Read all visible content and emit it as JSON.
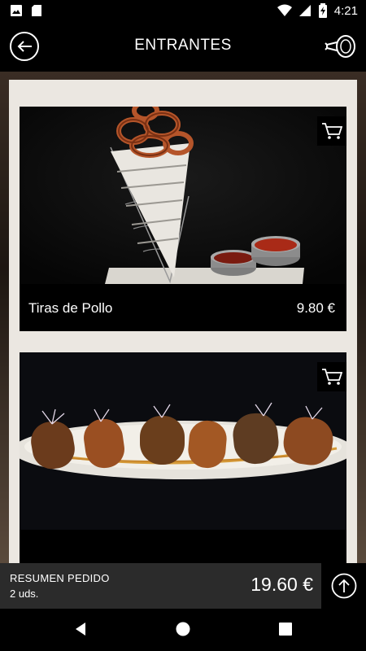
{
  "status_bar": {
    "time": "4:21",
    "left_icons": [
      "image-notification-icon",
      "sd-card-icon"
    ],
    "right_icons": [
      "wifi-icon",
      "signal-icon",
      "battery-icon"
    ]
  },
  "header": {
    "title": "ENTRANTES",
    "back_icon": "arrow-left-circle-icon",
    "menu_icon": "ham-leg-icon"
  },
  "products": [
    {
      "name": "Tiras de Pollo",
      "price": "9.80 €",
      "image": "onion-rings-cone-photo",
      "cart_icon": "shopping-cart-icon"
    },
    {
      "name": "",
      "price": "",
      "image": "croquettes-platter-photo",
      "cart_icon": "shopping-cart-icon"
    }
  ],
  "summary": {
    "label": "RESUMEN PEDIDO",
    "units": "2 uds.",
    "total": "19.60 €",
    "button_icon": "arrow-up-circle-icon"
  },
  "nav_bar": {
    "buttons": [
      "back-triangle-icon",
      "home-circle-icon",
      "recents-square-icon"
    ]
  },
  "colors": {
    "background": "#000000",
    "panel": "#ebe7e1",
    "summary_bar": "#2b2b2b",
    "text": "#ffffff"
  }
}
